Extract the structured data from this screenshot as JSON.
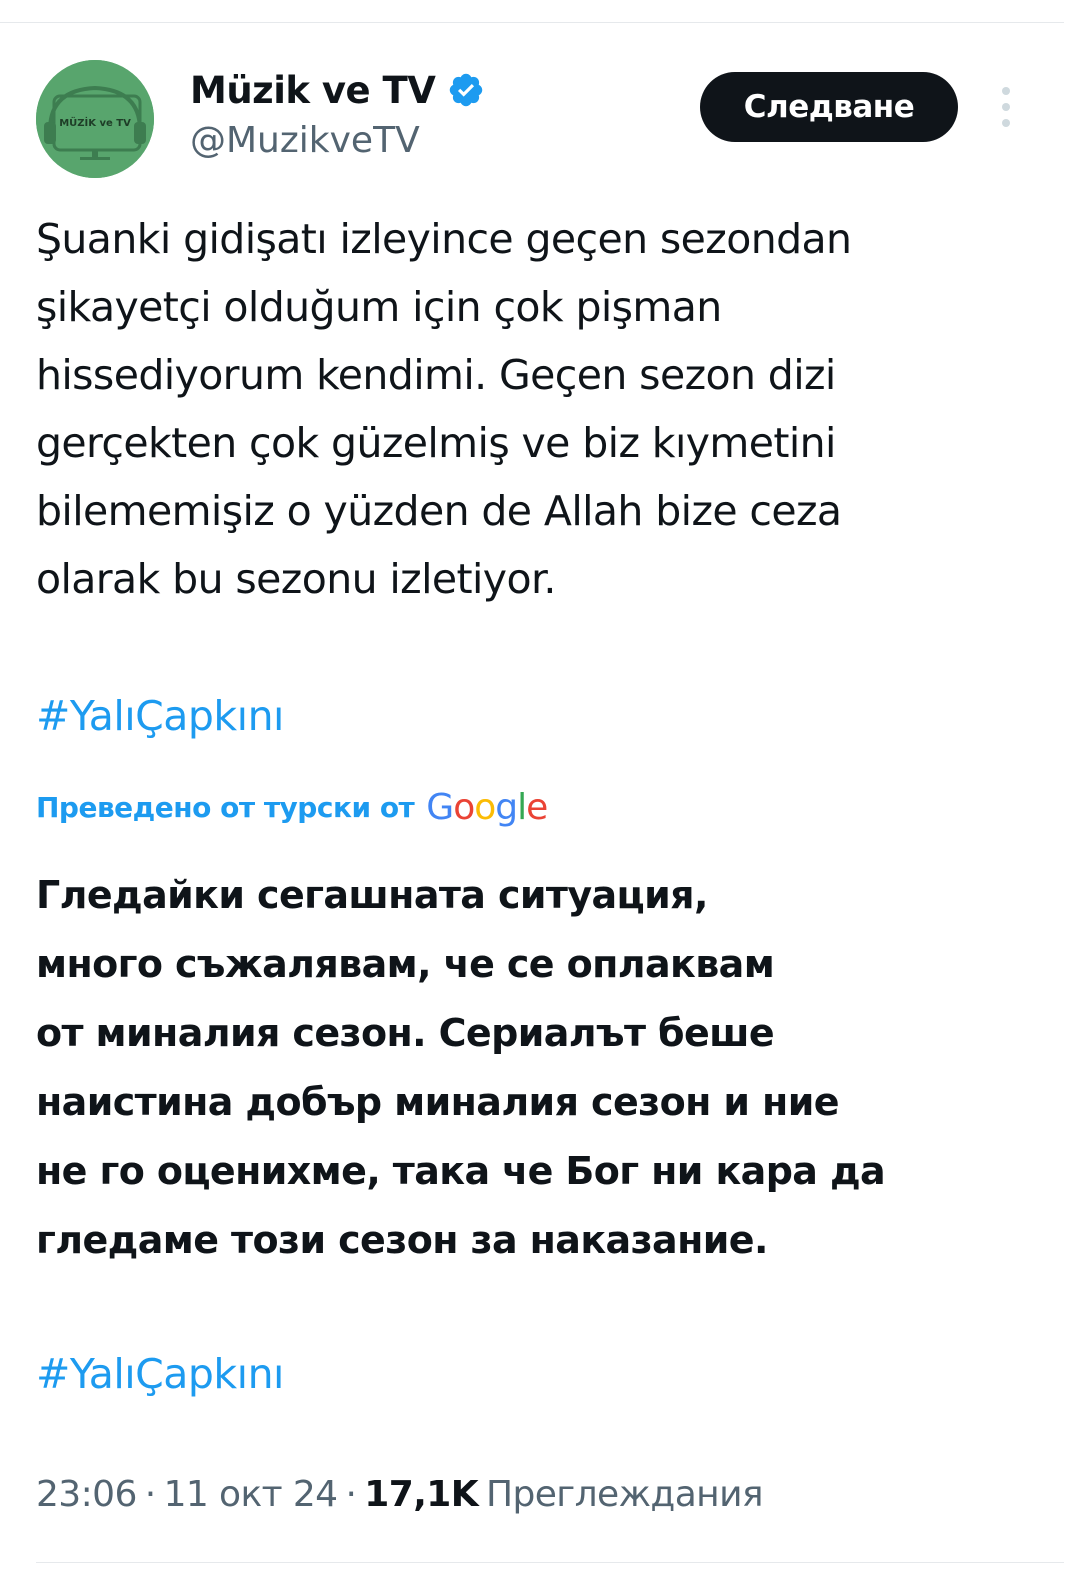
{
  "account": {
    "display_name": "Müzik ve TV",
    "handle": "@MuzikveTV",
    "avatar_text": "MÜZİK ve TV",
    "verified": true
  },
  "actions": {
    "follow_label": "Следване",
    "more_icon": "more-vertical-icon"
  },
  "tweet": {
    "text_lines": [
      "Şuanki gidişatı izleyince geçen sezondan",
      "şikayetçi olduğum için çok pişman",
      "hissediyorum kendimi. Geçen sezon dizi",
      "gerçekten çok güzelmiş ve biz kıymetini",
      "bilememişiz o yüzden de Allah bize ceza",
      "olarak bu sezonu izletiyor."
    ],
    "hashtag": "#YalıÇapkını"
  },
  "translation": {
    "label": "Преведено от турски от",
    "provider": "Google",
    "text_lines": [
      "Гледайки сегашната ситуация,",
      "много съжалявам, че се оплаквам",
      "от миналия сезон. Сериалът беше",
      "наистина добър миналия сезон и ние",
      "не го оценихме, така че Бог ни кара да",
      "гледаме този сезон за наказание."
    ],
    "hashtag": "#YalıÇapkını"
  },
  "meta": {
    "time": "23:06",
    "separator": "·",
    "date": "11 окт 24",
    "views_count": "17,1K",
    "views_label": "Преглеждания"
  },
  "colors": {
    "link_blue": "#1d9bf0",
    "text_primary": "#0f1419",
    "text_secondary": "#536471",
    "avatar_green": "#58a56d",
    "follow_bg": "#0f1419"
  }
}
